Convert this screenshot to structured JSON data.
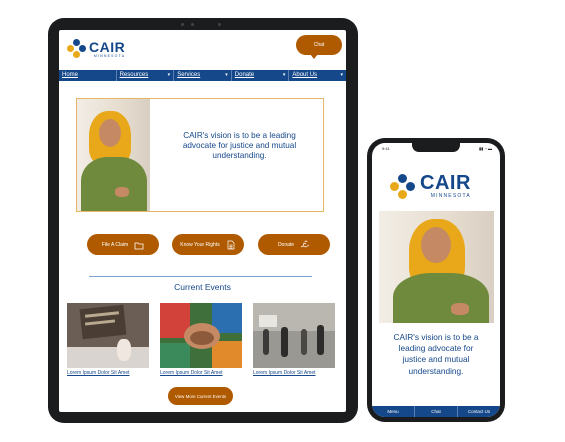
{
  "brand": {
    "name": "CAIR",
    "sub": "MINNESOTA",
    "primary": "#15488a",
    "accent": "#b05a00"
  },
  "tablet": {
    "chat_label": "Chat",
    "nav": [
      {
        "label": "Home",
        "has_caret": false
      },
      {
        "label": "Resources",
        "has_caret": true
      },
      {
        "label": "Services",
        "has_caret": true
      },
      {
        "label": "Donate",
        "has_caret": true
      },
      {
        "label": "About Us",
        "has_caret": true
      }
    ],
    "hero_text": "CAIR's vision is to be a leading advocate for justice and mutual understanding.",
    "buttons": [
      {
        "label": "File A Claim",
        "icon": "folder-icon"
      },
      {
        "label": "Know Your Rights",
        "icon": "document-icon"
      },
      {
        "label": "Donate",
        "icon": "donate-hand-icon"
      }
    ],
    "events_title": "Current Events",
    "events": [
      {
        "caption": "Lorem Ipsum Dolor Sit Amet"
      },
      {
        "caption": "Lorem Ipsum Dolor Sit Amet"
      },
      {
        "caption": "Lorem Ipsum Dolor Sit Amet"
      }
    ],
    "more_label": "View More Current Events"
  },
  "phone": {
    "time": "9:41",
    "status": "▮▮ ◔ ▬",
    "hero_text": "CAIR's vision is to be a leading advocate for justice and mutual understanding.",
    "bottom_bar": [
      "Menu",
      "Chat",
      "Contact Us"
    ]
  }
}
